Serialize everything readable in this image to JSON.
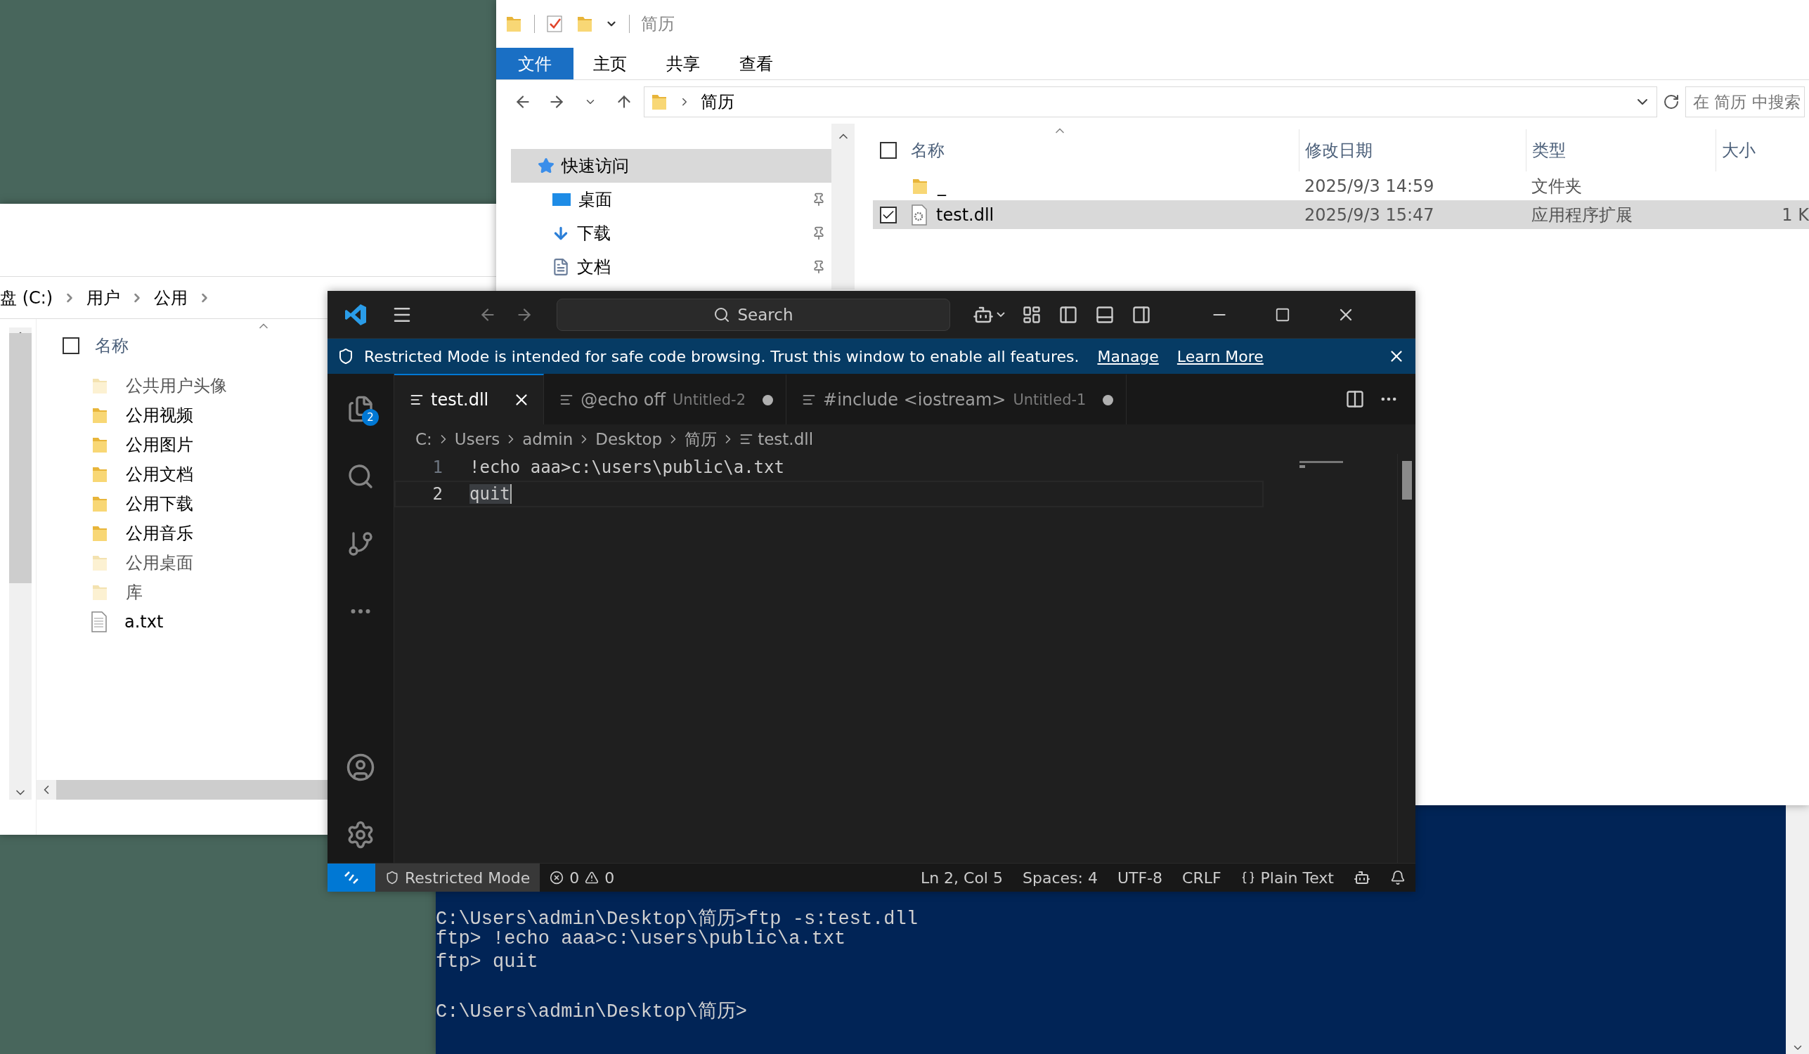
{
  "explorer_back": {
    "address": [
      "盘 (C:)",
      "用户",
      "公用"
    ],
    "columns": [
      "名称"
    ],
    "select_all_checked": false,
    "files": [
      {
        "name": "公共用户头像",
        "kind": "folder",
        "hidden": true
      },
      {
        "name": "公用视频",
        "kind": "folder",
        "hidden": false
      },
      {
        "name": "公用图片",
        "kind": "folder",
        "hidden": false
      },
      {
        "name": "公用文档",
        "kind": "folder",
        "hidden": false
      },
      {
        "name": "公用下载",
        "kind": "folder",
        "hidden": false
      },
      {
        "name": "公用音乐",
        "kind": "folder",
        "hidden": false
      },
      {
        "name": "公用桌面",
        "kind": "folder",
        "hidden": true
      },
      {
        "name": "库",
        "kind": "folder",
        "hidden": true
      },
      {
        "name": "a.txt",
        "kind": "file",
        "hidden": false
      }
    ]
  },
  "explorer_front": {
    "title": "简历",
    "ribbon_tabs": [
      {
        "label": "文件",
        "selected": true
      },
      {
        "label": "主页",
        "selected": false
      },
      {
        "label": "共享",
        "selected": false
      },
      {
        "label": "查看",
        "selected": false
      }
    ],
    "address": [
      "简历"
    ],
    "search": {
      "placeholder": "在 简历 中搜索"
    },
    "nav": [
      {
        "label": "快速访问",
        "kind": "star",
        "selected": true,
        "pinned": false
      },
      {
        "label": "桌面",
        "kind": "desktop",
        "selected": false,
        "pinned": true
      },
      {
        "label": "下载",
        "kind": "download",
        "selected": false,
        "pinned": true
      },
      {
        "label": "文档",
        "kind": "document",
        "selected": false,
        "pinned": true
      }
    ],
    "columns": [
      "名称",
      "修改日期",
      "类型",
      "大小"
    ],
    "select_all_checked": false,
    "rows": [
      {
        "name": "_",
        "kind": "folder",
        "modified": "2025/9/3 14:59",
        "type": "文件夹",
        "selected": false
      },
      {
        "name": "test.dll",
        "kind": "file",
        "modified": "2025/9/3 15:47",
        "type": "应用程序扩展",
        "size": "1 K",
        "selected": true
      }
    ]
  },
  "vscode": {
    "search": "Search",
    "explorer_badge": "2",
    "banner": {
      "text": "Restricted Mode is intended for safe code browsing. Trust this window to enable all features.",
      "links": [
        "Manage",
        "Learn More"
      ]
    },
    "tabs": [
      {
        "label": "test.dll",
        "selected": true,
        "modified": false
      },
      {
        "label": "@echo off",
        "detail": "Untitled-2",
        "selected": false,
        "modified": true
      },
      {
        "label": "#include <iostream>",
        "detail": "Untitled-1",
        "selected": false,
        "modified": true
      }
    ],
    "breadcrumbs": [
      "C:",
      "Users",
      "admin",
      "Desktop",
      "简历",
      "test.dll"
    ],
    "lines": [
      {
        "number": "1",
        "text": "!echo aaa>c:\\users\\public\\a.txt",
        "current": false
      },
      {
        "number": "2",
        "text": "quit",
        "current": true
      }
    ],
    "status": {
      "restricted": "Restricted Mode",
      "errors": "0",
      "warnings": "0",
      "items": [
        "Ln 2, Col 5",
        "Spaces: 4",
        "UTF-8",
        "CRLF"
      ],
      "language": "Plain Text"
    }
  },
  "console": {
    "blocks": [
      [
        "C:\\Users\\admin\\Desktop\\简历>ftp -s:test.dll",
        "ftp> !echo aaa>c:\\users\\public\\a.txt",
        "ftp> quit"
      ],
      [
        "C:\\Users\\admin\\Desktop\\简历>"
      ]
    ]
  }
}
